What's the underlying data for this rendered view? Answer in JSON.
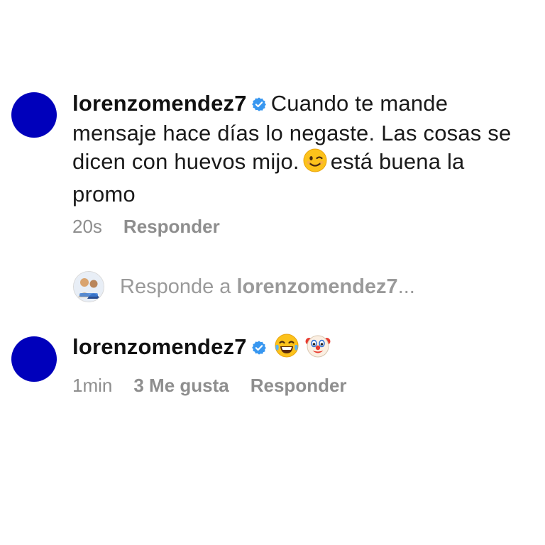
{
  "colors": {
    "avatar": "#0000bb",
    "verified": "#3897f0",
    "meta_text": "#8e8e8e",
    "body_text": "#1a1a1a"
  },
  "comments": [
    {
      "username": "lorenzomendez7",
      "verified_icon": "verified-badge-icon",
      "text_before_emoji": "Cuando te mande mensaje hace días lo negaste. Las cosas se dicen con huevos mijo.",
      "emoji": "winking-face-emoji",
      "text_after_emoji": "está buena la promo",
      "time": "20s",
      "reply_label": "Responder"
    },
    {
      "username": "lorenzomendez7",
      "verified_icon": "verified-badge-icon",
      "emojis": [
        "tears-of-joy-emoji",
        "clown-face-emoji"
      ],
      "time": "1min",
      "likes_label": "3 Me gusta",
      "reply_label": "Responder"
    }
  ],
  "reply_input": {
    "prefix": "Responde a",
    "username": "lorenzomendez7",
    "ellipsis": "..."
  }
}
